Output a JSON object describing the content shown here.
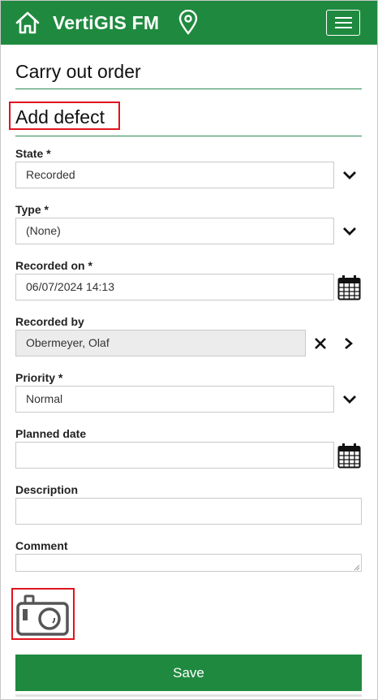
{
  "header": {
    "app_title": "VertiGIS FM"
  },
  "page": {
    "title": "Carry out order",
    "section": "Add defect"
  },
  "form": {
    "state": {
      "label": "State *",
      "value": "Recorded"
    },
    "type": {
      "label": "Type *",
      "value": "(None)"
    },
    "recorded_on": {
      "label": "Recorded on *",
      "value": "06/07/2024 14:13"
    },
    "recorded_by": {
      "label": "Recorded by",
      "value": "Obermeyer, Olaf"
    },
    "priority": {
      "label": "Priority *",
      "value": "Normal"
    },
    "planned_date": {
      "label": "Planned date",
      "value": ""
    },
    "description": {
      "label": "Description",
      "value": ""
    },
    "comment": {
      "label": "Comment",
      "value": ""
    }
  },
  "actions": {
    "save_label": "Save"
  },
  "icons": {
    "home": "home-icon",
    "pin": "location-pin-icon",
    "menu": "hamburger-menu-icon",
    "dropdown": "chevron-down-icon",
    "calendar": "calendar-icon",
    "clear": "close-icon",
    "navigate": "chevron-right-icon",
    "camera": "camera-icon"
  },
  "colors": {
    "brand": "#1f8a3f",
    "highlight": "#e0141c",
    "rule": "#2b8a55"
  }
}
